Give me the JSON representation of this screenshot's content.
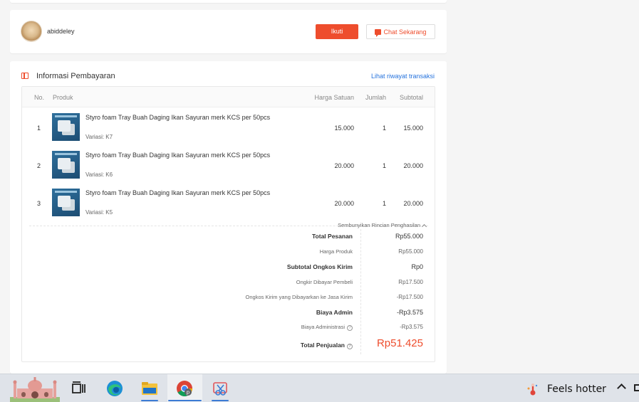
{
  "seller": {
    "name": "abiddeley",
    "follow_label": "Ikuti",
    "chat_label": "Chat Sekarang"
  },
  "payment": {
    "title": "Informasi Pembayaran",
    "history_link": "Lihat riwayat transaksi",
    "columns": {
      "no": "No.",
      "product": "Produk",
      "unit_price": "Harga Satuan",
      "qty": "Jumlah",
      "subtotal": "Subtotal"
    },
    "items": [
      {
        "no": "1",
        "name": "Styro foam Tray Buah Daging Ikan Sayuran merk KCS per 50pcs",
        "variant": "Variasi: K7",
        "price": "15.000",
        "qty": "1",
        "subtotal": "15.000"
      },
      {
        "no": "2",
        "name": "Styro foam Tray Buah Daging Ikan Sayuran merk KCS per 50pcs",
        "variant": "Variasi: K6",
        "price": "20.000",
        "qty": "1",
        "subtotal": "20.000"
      },
      {
        "no": "3",
        "name": "Styro foam Tray Buah Daging Ikan Sayuran merk KCS per 50pcs",
        "variant": "Variasi: K5",
        "price": "20.000",
        "qty": "1",
        "subtotal": "20.000"
      }
    ],
    "toggle_label": "Sembunyikan Rincian Penghasilan",
    "summary": {
      "total_pesanan_label": "Total Pesanan",
      "total_pesanan": "Rp55.000",
      "harga_produk_label": "Harga Produk",
      "harga_produk": "Rp55.000",
      "subtotal_ongkir_label": "Subtotal Ongkos Kirim",
      "subtotal_ongkir": "Rp0",
      "ongkir_pembeli_label": "Ongkir Dibayar Pembeli",
      "ongkir_pembeli": "Rp17.500",
      "ongkir_jasa_label": "Ongkos Kirim yang Dibayarkan ke Jasa Kirim",
      "ongkir_jasa": "-Rp17.500",
      "biaya_admin_label": "Biaya Admin",
      "biaya_admin": "-Rp3.575",
      "biaya_administrasi_label": "Biaya Administrasi",
      "biaya_administrasi": "-Rp3.575",
      "total_penjualan_label": "Total Penjualan",
      "total_penjualan": "Rp51.425"
    }
  },
  "taskbar": {
    "weather_text": "Feels hotter",
    "icons": [
      "mosque-widget-icon",
      "task-view-icon",
      "edge-icon",
      "file-explorer-icon",
      "chrome-icon",
      "snipping-tool-icon"
    ]
  },
  "colors": {
    "accent": "#ee4d2d",
    "link": "#2673dd"
  }
}
